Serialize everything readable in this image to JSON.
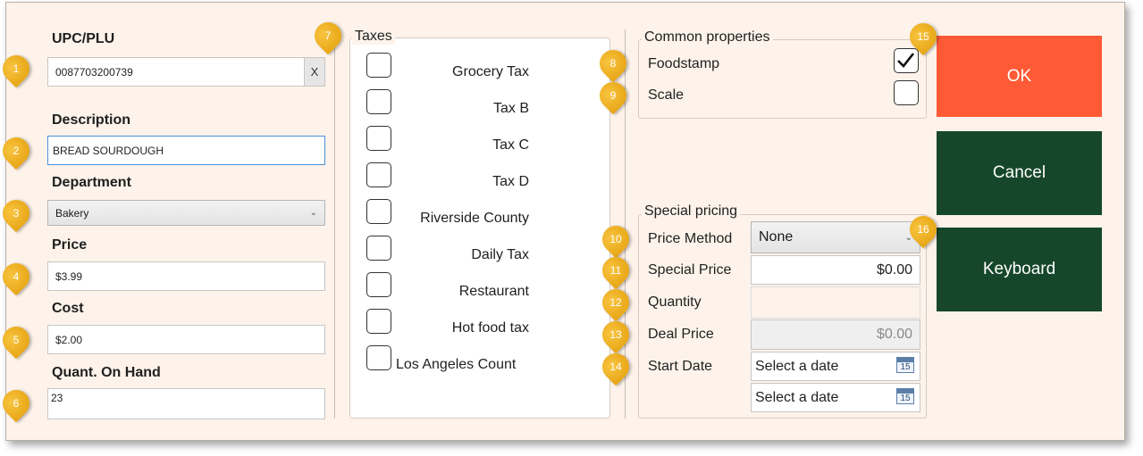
{
  "left": {
    "upc_label": "UPC/PLU",
    "upc_value": "0087703200739",
    "upc_clear": "X",
    "description_label": "Description",
    "description_value": "BREAD SOURDOUGH",
    "department_label": "Department",
    "department_value": "Bakery",
    "price_label": "Price",
    "price_value": "$3.99",
    "cost_label": "Cost",
    "cost_value": "$2.00",
    "qoh_label": "Quant. On Hand",
    "qoh_value": "23"
  },
  "taxes": {
    "title": "Taxes",
    "items": [
      {
        "label": "Grocery Tax",
        "checked": false
      },
      {
        "label": "Tax B",
        "checked": false
      },
      {
        "label": "Tax C",
        "checked": false
      },
      {
        "label": "Tax D",
        "checked": false
      },
      {
        "label": "Riverside County",
        "checked": false
      },
      {
        "label": "Daily Tax",
        "checked": false
      },
      {
        "label": "Restaurant",
        "checked": false
      },
      {
        "label": "Hot food tax",
        "checked": false
      },
      {
        "label": "Los Angeles Count",
        "checked": false
      }
    ]
  },
  "common": {
    "title": "Common properties",
    "foodstamp_label": "Foodstamp",
    "foodstamp_checked": true,
    "scale_label": "Scale",
    "scale_checked": false
  },
  "special": {
    "title": "Special pricing",
    "price_method_label": "Price Method",
    "price_method_value": "None",
    "special_price_label": "Special Price",
    "special_price_value": "$0.00",
    "quantity_label": "Quantity",
    "quantity_value": "",
    "deal_price_label": "Deal Price",
    "deal_price_value": "$0.00",
    "start_date_label": "Start Date",
    "start_date_placeholder": "Select a date",
    "end_date_placeholder": "Select a date",
    "calendar_day": "15"
  },
  "buttons": {
    "ok": "OK",
    "cancel": "Cancel",
    "keyboard": "Keyboard"
  },
  "badges": [
    "1",
    "2",
    "3",
    "4",
    "5",
    "6",
    "7",
    "8",
    "9",
    "10",
    "11",
    "12",
    "13",
    "14",
    "15",
    "16"
  ],
  "colors": {
    "ok": "#ff5a36",
    "cancel": "#16472a",
    "keyboard": "#16472a",
    "badge": "#f0b020",
    "background": "#fdf3ea"
  }
}
